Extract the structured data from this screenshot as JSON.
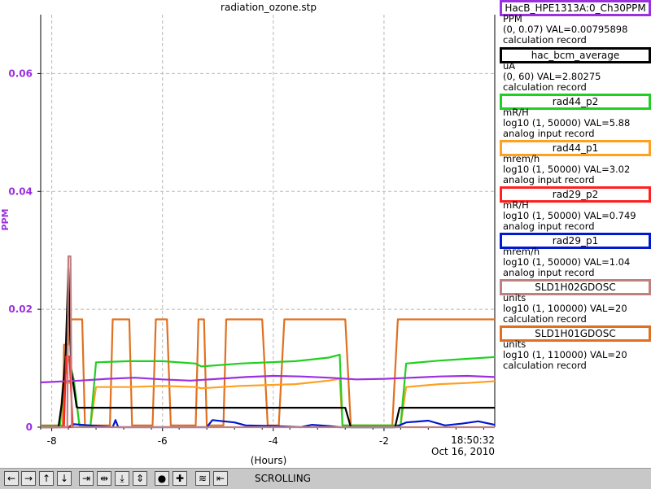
{
  "chart_data": {
    "type": "line",
    "title": "radiation_ozone.stp",
    "xlabel": "(Hours)",
    "ylabel": "PPM",
    "xlim": [
      -8.2,
      0
    ],
    "ylim": [
      0,
      0.07
    ],
    "x_ticks": [
      -8,
      -6,
      -4,
      -2
    ],
    "y_ticks": [
      0,
      0.02,
      0.04,
      0.06
    ],
    "x_tick_labels": [
      "-8",
      "-6",
      "-4",
      "-2"
    ],
    "y_tick_labels": [
      "0",
      "0.02",
      "0.04",
      "0.06"
    ],
    "end_time": "18:50:32",
    "end_date": "Oct 16, 2010",
    "grid": true,
    "series": [
      {
        "name": "SLD1H01GDOSC",
        "color": "#e07020",
        "x": [
          -8.2,
          -7.8,
          -7.78,
          -7.7,
          -7.68,
          -7.45,
          -7.4,
          -6.95,
          -6.9,
          -6.6,
          -6.55,
          -6.18,
          -6.12,
          -5.92,
          -5.85,
          -5.4,
          -5.35,
          -5.25,
          -5.2,
          -4.9,
          -4.85,
          -4.2,
          -4.1,
          -3.9,
          -3.8,
          -3.65,
          -3.6,
          -2.7,
          -2.6,
          -1.85,
          -1.75,
          -1.7,
          -1.65,
          0
        ],
        "y": [
          0.0003,
          0.0003,
          0.014,
          0.014,
          0.0183,
          0.0183,
          0.0003,
          0.0003,
          0.0183,
          0.0183,
          0.0003,
          0.0003,
          0.0183,
          0.0183,
          0.0003,
          0.0003,
          0.0183,
          0.0183,
          0.0003,
          0.0003,
          0.0183,
          0.0183,
          0.0003,
          0.0003,
          0.0183,
          0.0183,
          0.0183,
          0.0183,
          0.0003,
          0.0003,
          0.0183,
          0.0183,
          0.0183,
          0.0183
        ]
      },
      {
        "name": "rad44_p1",
        "color": "#ffa020",
        "x": [
          -8.2,
          -7.85,
          -7.8,
          -7.6,
          -7.5,
          -7.3,
          -7.2,
          -6.6,
          -6.0,
          -5.4,
          -5.3,
          -4.6,
          -3.6,
          -3.0,
          -2.8,
          -2.75,
          -2.65,
          -1.7,
          -1.6,
          -1.0,
          -0.5,
          0
        ],
        "y": [
          0.0002,
          0.0002,
          0.0075,
          0.0075,
          0.0003,
          0.0003,
          0.0068,
          0.0068,
          0.007,
          0.0068,
          0.0066,
          0.007,
          0.0073,
          0.0079,
          0.0082,
          0.0003,
          0.0003,
          0.0003,
          0.0068,
          0.0073,
          0.0075,
          0.0078
        ]
      },
      {
        "name": "rad44_p2",
        "color": "#20d020",
        "x": [
          -8.2,
          -7.85,
          -7.8,
          -7.7,
          -7.6,
          -7.5,
          -7.3,
          -7.2,
          -6.6,
          -6.0,
          -5.4,
          -5.3,
          -4.6,
          -3.6,
          -3.0,
          -2.8,
          -2.75,
          -2.65,
          -1.7,
          -1.6,
          -1.0,
          -0.5,
          0
        ],
        "y": [
          0.0002,
          0.0002,
          0.006,
          0.012,
          0.008,
          0.0003,
          0.0003,
          0.011,
          0.0112,
          0.0112,
          0.0108,
          0.0103,
          0.0108,
          0.0112,
          0.0118,
          0.0123,
          0.0003,
          0.0003,
          0.0003,
          0.0108,
          0.0113,
          0.0116,
          0.0119
        ]
      },
      {
        "name": "hac_bcm_average",
        "color": "#000000",
        "x": [
          -8.2,
          -7.88,
          -7.82,
          -7.75,
          -7.7,
          -7.65,
          -7.55,
          -7.52,
          -7.4,
          -7.3,
          -6.95,
          -6.9,
          -5.4,
          -5.35,
          -5.25,
          -5.2,
          -4.2,
          -4.1,
          -2.7,
          -2.6,
          -1.8,
          -1.72,
          0
        ],
        "y": [
          0,
          0,
          0.004,
          0.012,
          0.027,
          0.01,
          0.0034,
          0.0033,
          0.0033,
          0.0033,
          0.0033,
          0.0033,
          0.0033,
          0.0033,
          0.0033,
          0.0033,
          0.0033,
          0.0033,
          0.0033,
          0,
          0,
          0.0033,
          0.0033
        ]
      },
      {
        "name": "HacB_HPE1313A:0_Ch30PPM",
        "color": "#9b30e0",
        "x": [
          -8.2,
          -7.5,
          -7.0,
          -6.5,
          -6.0,
          -5.5,
          -5.0,
          -4.5,
          -4.0,
          -3.5,
          -3.0,
          -2.5,
          -2.0,
          -1.5,
          -1.0,
          -0.5,
          0
        ],
        "y": [
          0.0076,
          0.0079,
          0.0082,
          0.0084,
          0.0081,
          0.0079,
          0.0082,
          0.0085,
          0.0087,
          0.0086,
          0.0084,
          0.0081,
          0.0082,
          0.0084,
          0.0086,
          0.0087,
          0.0085
        ]
      },
      {
        "name": "rad29_p1",
        "color": "#0018d0",
        "x": [
          -8.2,
          -7.7,
          -7.6,
          -6.9,
          -6.85,
          -6.8,
          -5.2,
          -5.1,
          -4.7,
          -4.5,
          -4.0,
          -3.5,
          -3.3,
          -3.0,
          -2.8,
          -1.8,
          -1.6,
          -1.2,
          -0.9,
          -0.6,
          -0.3,
          0
        ],
        "y": [
          0,
          0,
          0.0005,
          0,
          0.0012,
          0,
          0,
          0.0012,
          0.0008,
          0.0003,
          0.0002,
          0,
          0.0004,
          0.0002,
          0,
          0,
          0.0008,
          0.0011,
          0.0003,
          0.0006,
          0.001,
          0.0004
        ]
      },
      {
        "name": "rad29_p2",
        "color": "#ff2020",
        "x": [
          -8.2,
          -7.78,
          -7.74,
          -7.68,
          -7.62,
          -8.2
        ],
        "y": [
          0,
          0,
          0.012,
          0.012,
          0,
          0
        ]
      },
      {
        "name": "SLD1H02GDOSC",
        "color": "#c08080",
        "x": [
          -8.2,
          -7.72,
          -7.7,
          -7.66,
          -7.64,
          0
        ],
        "y": [
          0,
          0,
          0.029,
          0.029,
          0,
          0
        ]
      }
    ]
  },
  "legend": [
    {
      "name": "HacB_HPE1313A:0_Ch30PPM",
      "border": "#9b30e0",
      "units": "PPM",
      "range": "(0, 0.07) VAL=0.00795898",
      "record": "calculation record"
    },
    {
      "name": "hac_bcm_average",
      "border": "#000000",
      "units": "uA",
      "range": "(0, 60) VAL=2.80275",
      "record": "calculation record"
    },
    {
      "name": "rad44_p2",
      "border": "#20d020",
      "units": "mR/H",
      "range": "log10 (1, 50000) VAL=5.88",
      "record": "analog input record"
    },
    {
      "name": "rad44_p1",
      "border": "#ffa020",
      "units": "mrem/h",
      "range": "log10 (1, 50000) VAL=3.02",
      "record": "analog input record"
    },
    {
      "name": "rad29_p2",
      "border": "#ff2020",
      "units": "mR/H",
      "range": "log10 (1, 50000) VAL=0.749",
      "record": "analog input record"
    },
    {
      "name": "rad29_p1",
      "border": "#0018d0",
      "units": "mrem/h",
      "range": "log10 (1, 50000) VAL=1.04",
      "record": "analog input record"
    },
    {
      "name": "SLD1H02GDOSC",
      "border": "#c08080",
      "units": "units",
      "range": "log10 (1, 100000) VAL=20",
      "record": "calculation record"
    },
    {
      "name": "SLD1H01GDOSC",
      "border": "#e07020",
      "units": "units",
      "range": "log10 (1, 110000) VAL=20",
      "record": "calculation record"
    }
  ],
  "toolbar": {
    "buttons": [
      {
        "name": "pan-left-button",
        "glyph": "←"
      },
      {
        "name": "pan-right-button",
        "glyph": "→"
      },
      {
        "name": "pan-up-button",
        "glyph": "↑"
      },
      {
        "name": "pan-down-button",
        "glyph": "↓"
      },
      {
        "name": "zoom-in-x-button",
        "glyph": "⇥"
      },
      {
        "name": "zoom-out-x-button",
        "glyph": "⇹"
      },
      {
        "name": "zoom-in-y-button",
        "glyph": "⤓"
      },
      {
        "name": "zoom-out-y-button",
        "glyph": "⇕"
      },
      {
        "name": "reset-button",
        "glyph": "●"
      },
      {
        "name": "add-button",
        "glyph": "✚"
      },
      {
        "name": "autoscale-button",
        "glyph": "≋"
      },
      {
        "name": "scroll-mode-button",
        "glyph": "⇤"
      }
    ],
    "status": "SCROLLING"
  }
}
